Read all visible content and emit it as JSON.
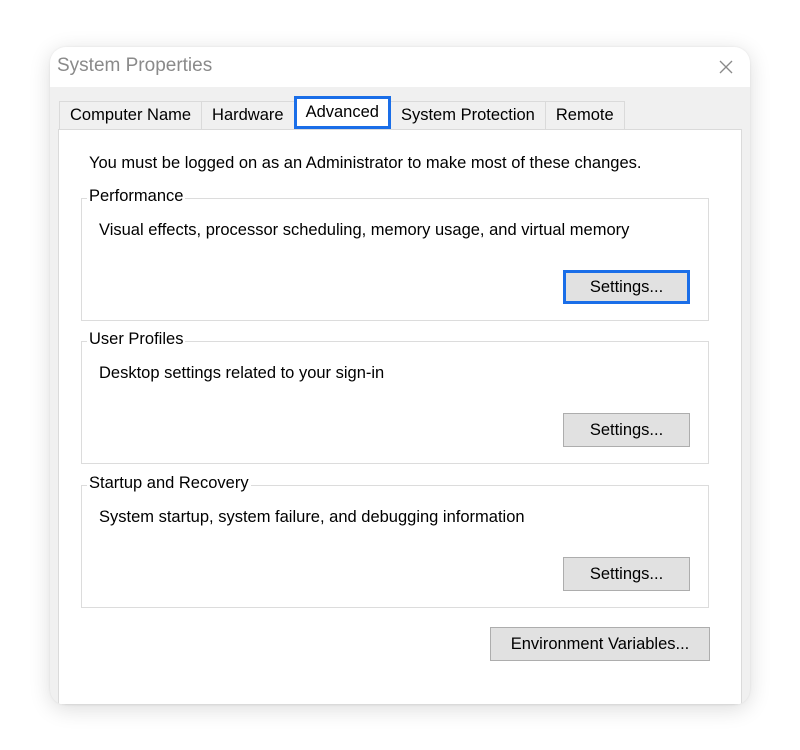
{
  "window": {
    "title": "System Properties",
    "close_icon": "close-icon"
  },
  "tabs": [
    {
      "label": "Computer Name",
      "active": false
    },
    {
      "label": "Hardware",
      "active": false
    },
    {
      "label": "Advanced",
      "active": true
    },
    {
      "label": "System Protection",
      "active": false
    },
    {
      "label": "Remote",
      "active": false
    }
  ],
  "advanced": {
    "admin_note": "You must be logged on as an Administrator to make most of these changes.",
    "groups": [
      {
        "title": "Performance",
        "description": "Visual effects, processor scheduling, memory usage, and virtual memory",
        "button_label": "Settings...",
        "focused": true
      },
      {
        "title": "User Profiles",
        "description": "Desktop settings related to your sign-in",
        "button_label": "Settings...",
        "focused": false
      },
      {
        "title": "Startup and Recovery",
        "description": "System startup, system failure, and debugging information",
        "button_label": "Settings...",
        "focused": false
      }
    ],
    "env_button_label": "Environment Variables..."
  },
  "colors": {
    "highlight": "#1a6ee8",
    "dialog_background": "#f0f0f0",
    "button_face": "#e1e1e1"
  }
}
